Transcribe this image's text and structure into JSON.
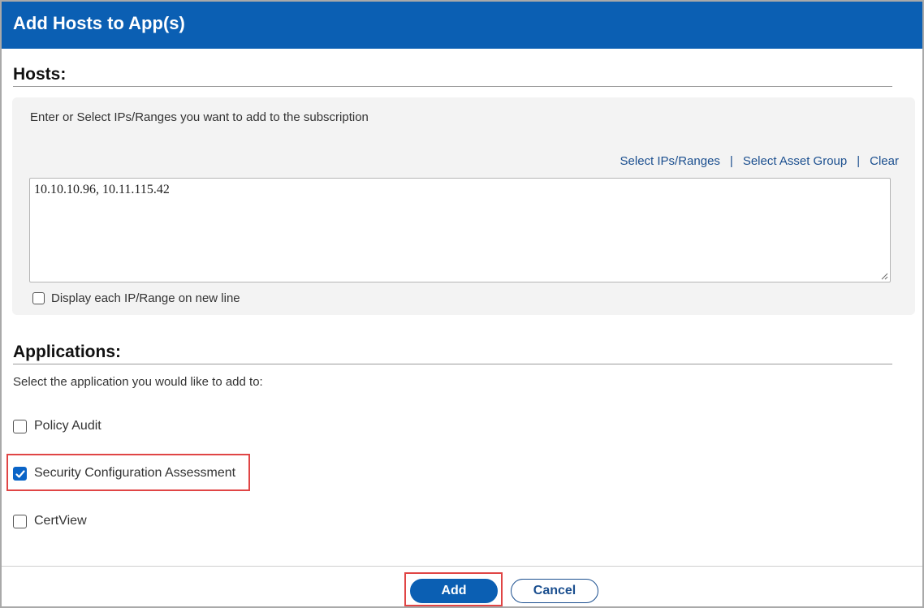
{
  "dialog": {
    "title": "Add Hosts to App(s)"
  },
  "hosts": {
    "heading": "Hosts:",
    "instructions": "Enter or Select IPs/Ranges you want to add to the subscription",
    "links": {
      "select_ips": "Select IPs/Ranges",
      "separator": "|",
      "select_asset_group": "Select Asset Group",
      "clear": "Clear"
    },
    "ip_value": "10.10.10.96, 10.11.115.42",
    "newline_option": {
      "label": "Display each IP/Range on new line",
      "checked": false
    }
  },
  "applications": {
    "heading": "Applications:",
    "instructions": "Select the application you would like to add to:",
    "options": [
      {
        "label": "Policy Audit",
        "checked": false
      },
      {
        "label": "Security Configuration Assessment",
        "checked": true
      },
      {
        "label": "CertView",
        "checked": false
      }
    ]
  },
  "footer": {
    "add_label": "Add",
    "cancel_label": "Cancel"
  },
  "colors": {
    "header_blue": "#0b5fb3",
    "link_blue": "#1b4f8f",
    "highlight_red": "#e04545",
    "checkbox_checked": "#0a64c7"
  },
  "icons": {
    "checkmark": "check-icon",
    "resize": "resize-grip-icon"
  }
}
